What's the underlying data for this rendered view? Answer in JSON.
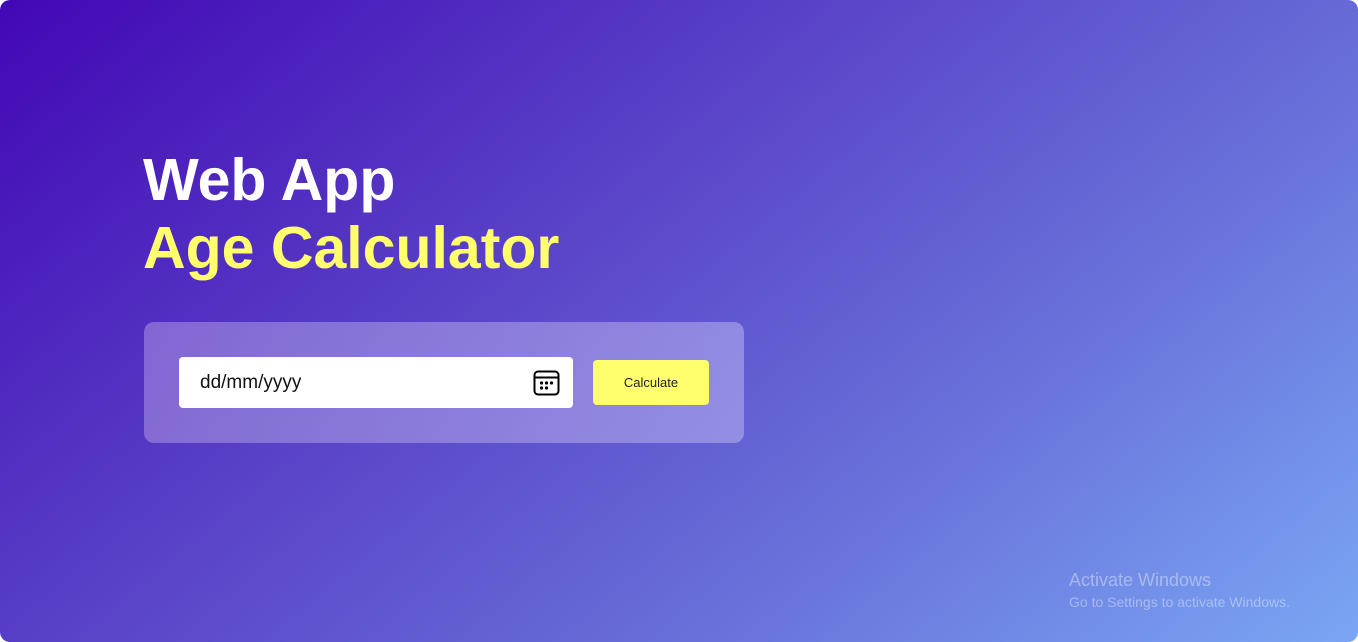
{
  "header": {
    "title_line1": "Web App",
    "title_line2": "Age Calculator"
  },
  "form": {
    "date_input": {
      "placeholder": "dd/mm/yyyy",
      "value": "",
      "icon": "calendar-icon"
    },
    "calculate_label": "Calculate"
  },
  "watermark": {
    "title": "Activate Windows",
    "subtitle": "Go to Settings to activate Windows."
  },
  "colors": {
    "background_start": "#4207b5",
    "background_end": "#7aa6f4",
    "accent_yellow": "#ffff6e",
    "heading_white": "#ffffff",
    "input_background": "#ffffff"
  }
}
